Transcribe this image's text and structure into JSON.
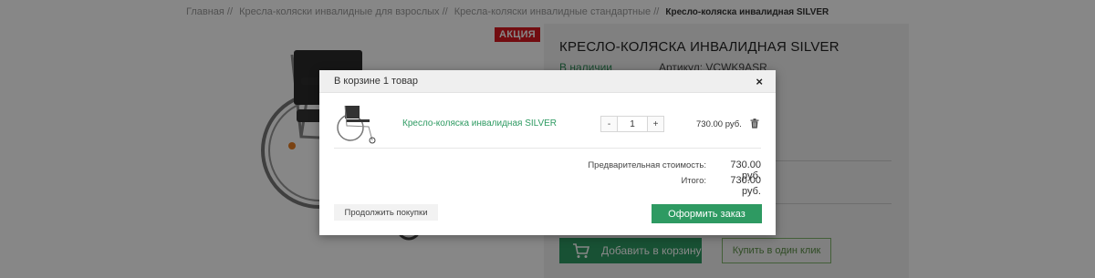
{
  "breadcrumb": {
    "items": [
      "Главная //",
      "Кресла-коляски инвалидные для взрослых //",
      "Кресла-коляски инвалидные стандартные //"
    ],
    "current": "Кресло-коляска инвалидная SILVER"
  },
  "product": {
    "badge": "АКЦИЯ",
    "title": "КРЕСЛО-КОЛЯСКА ИНВАЛИДНАЯ SILVER",
    "stock": "В наличии",
    "sku": "Артикул: VCWK9ASR",
    "add_to_cart": "Добавить в корзину",
    "buy_one_click": "Купить в один клик"
  },
  "modal": {
    "title": "В корзине 1 товар",
    "close": "×",
    "item": {
      "name": "Кресло-коляска инвалидная SILVER",
      "quantity": "1",
      "minus": "-",
      "plus": "+",
      "price": "730.00 руб."
    },
    "totals": {
      "subtotal_label": "Предварительная стоимость:",
      "subtotal_value": "730.00 руб.",
      "total_label": "Итого:",
      "total_value": "730.00 руб."
    },
    "continue": "Продолжить покупки",
    "checkout": "Оформить заказ"
  },
  "colors": {
    "accent_green": "#2e9a62",
    "badge_red": "#d71920",
    "overlay": "rgba(0,0,0,0.47)"
  },
  "icons": [
    "close-icon",
    "trash-icon",
    "cart-icon",
    "wheelchair-image"
  ]
}
